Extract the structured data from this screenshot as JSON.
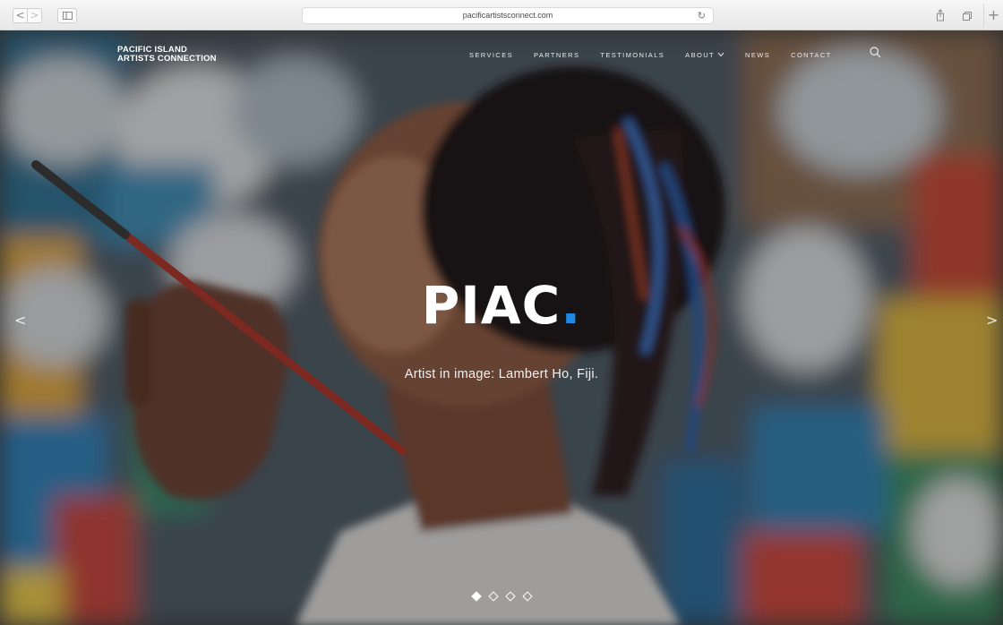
{
  "browser": {
    "url": "pacificartistsconnect.com",
    "back_label": "<",
    "forward_label": ">",
    "new_tab_label": "+"
  },
  "header": {
    "logo_line1": "PACIFIC ISLAND",
    "logo_line2": "ARTISTS CONNECTION",
    "nav": {
      "services": "SERVICES",
      "partners": "PARTNERS",
      "testimonials": "TESTIMONIALS",
      "about": "ABOUT",
      "news": "NEWS",
      "contact": "CONTACT"
    }
  },
  "hero": {
    "title": "PIAC",
    "title_dot": ".",
    "caption": "Artist in image: Lambert Ho, Fiji.",
    "prev_arrow": "<",
    "next_arrow": ">",
    "slide_count": 4,
    "active_slide": 1
  },
  "colors": {
    "accent": "#1e88e5",
    "text": "#ffffff"
  }
}
